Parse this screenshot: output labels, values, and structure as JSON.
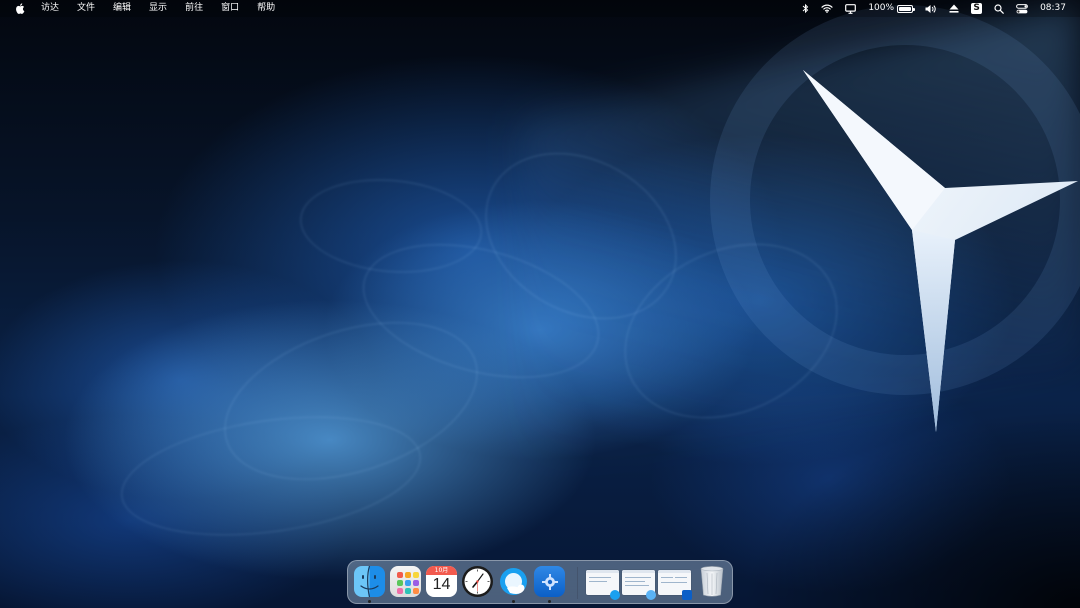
{
  "menubar": {
    "apple_icon": "apple-logo-icon",
    "items": [
      "访达",
      "文件",
      "编辑",
      "显示",
      "前往",
      "窗口",
      "帮助"
    ],
    "status": {
      "bluetooth_icon": "bluetooth-icon",
      "wifi_icon": "wifi-icon",
      "display_icon": "display-icon",
      "battery_percent": "100%",
      "battery_level": 1.0,
      "volume_icon": "volume-icon",
      "eject_icon": "eject-icon",
      "app_icon": "s-app-icon",
      "app_letter": "S",
      "search_icon": "search-icon",
      "control_center_icon": "control-center-icon",
      "time": "08:37"
    }
  },
  "dock": {
    "apps": [
      {
        "name": "finder",
        "icon": "finder-icon",
        "running": true
      },
      {
        "name": "launchpad",
        "icon": "launchpad-icon",
        "running": false
      },
      {
        "name": "calendar",
        "icon": "calendar-icon",
        "running": false,
        "month": "10月",
        "day": "14"
      },
      {
        "name": "clock",
        "icon": "clock-icon",
        "running": false
      },
      {
        "name": "qq",
        "icon": "qq-icon",
        "running": true
      },
      {
        "name": "system-preferences",
        "icon": "gear-icon",
        "running": true
      }
    ],
    "minimized_windows": [
      {
        "name": "window-1",
        "badge": "qq-badge-icon"
      },
      {
        "name": "window-2",
        "badge": "finder-badge-icon"
      },
      {
        "name": "window-3",
        "badge": "preferences-badge-icon"
      }
    ],
    "trash_icon": "trash-icon"
  },
  "colors": {
    "accent_blue": "#1d8de8",
    "calendar_red": "#f25a4e",
    "wallpaper_dark": "#050c18"
  }
}
